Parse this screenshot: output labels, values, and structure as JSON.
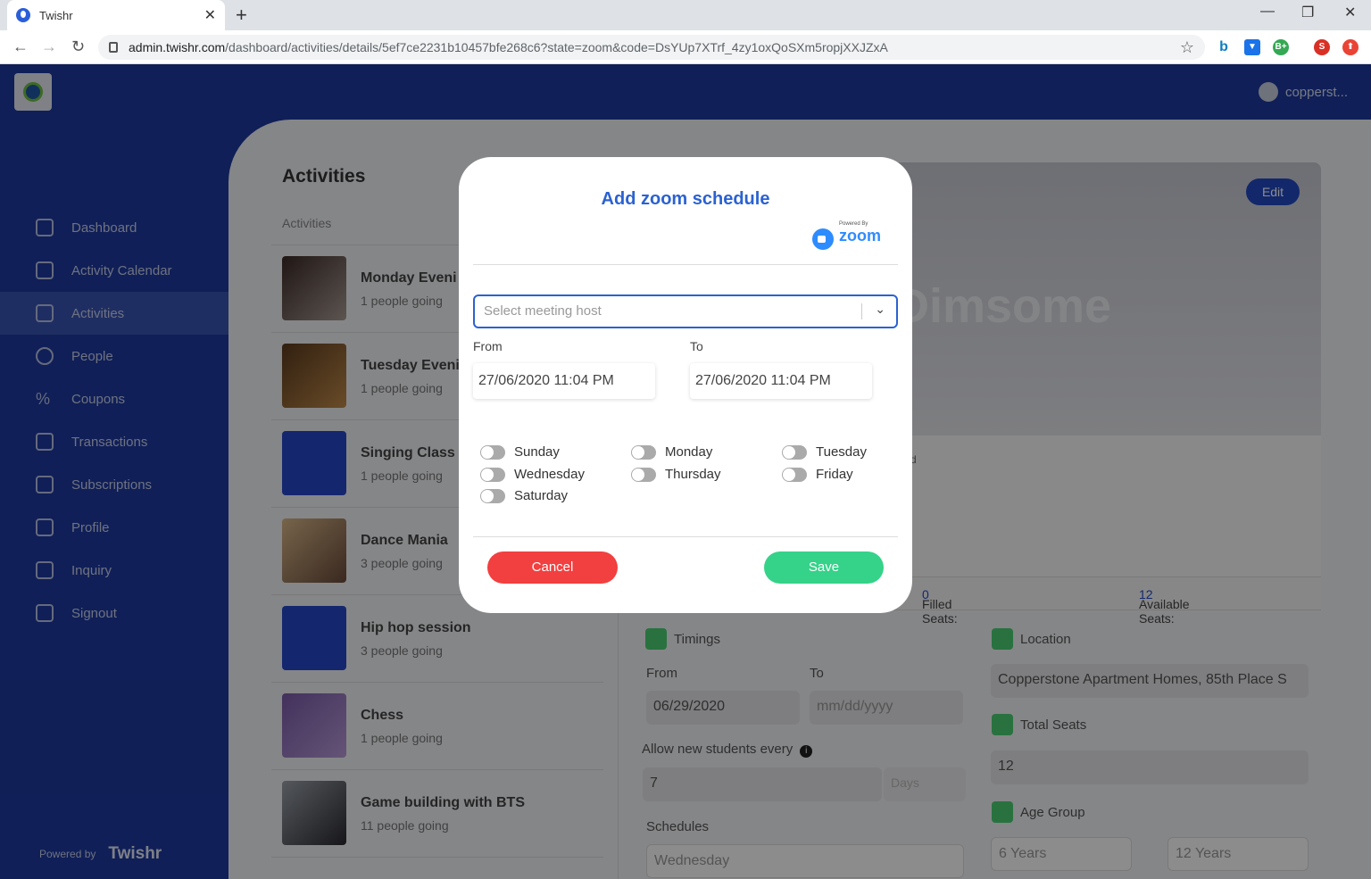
{
  "browser": {
    "tab_title": "Twishr",
    "url_host": "admin.twishr.com",
    "url_path": "/dashboard/activities/details/5ef7ce2231b10457bfe268c6?state=zoom&code=DsYUp7XTrf_4zy1oxQoSXm5ropjXXJZxA",
    "ext_s_label": "S",
    "ext_b_label": "B+"
  },
  "header": {
    "username": "copperst..."
  },
  "sidebar": {
    "items": [
      {
        "label": "Dashboard",
        "icon": "bar-chart-icon"
      },
      {
        "label": "Activity Calendar",
        "icon": "calendar-icon"
      },
      {
        "label": "Activities",
        "icon": "activity-icon"
      },
      {
        "label": "People",
        "icon": "person-icon"
      },
      {
        "label": "Coupons",
        "icon": "percent-icon"
      },
      {
        "label": "Transactions",
        "icon": "dollar-icon"
      },
      {
        "label": "Subscriptions",
        "icon": "list-icon"
      },
      {
        "label": "Profile",
        "icon": "square-icon"
      },
      {
        "label": "Inquiry",
        "icon": "square-icon"
      },
      {
        "label": "Signout",
        "icon": "signout-icon"
      }
    ],
    "active": "Activities",
    "powered_by": "Powered by",
    "brand": "Twishr"
  },
  "main": {
    "title": "Activities",
    "subtitle": "Activities",
    "activities": [
      {
        "title": "Monday Eveni",
        "sub": "1 people going"
      },
      {
        "title": "Tuesday Eveni",
        "sub": "1 people going"
      },
      {
        "title": "Singing Class",
        "sub": "1 people going"
      },
      {
        "title": "Dance Mania",
        "sub": "3 people going"
      },
      {
        "title": "Hip hop session",
        "sub": "3 people going"
      },
      {
        "title": "Chess",
        "sub": "1 people going"
      },
      {
        "title": "Game building with BTS",
        "sub": "11 people going"
      }
    ],
    "banner_text": "Dimsome",
    "edit_label": "Edit",
    "filled_seats_label": "Filled Seats:",
    "filled_seats_value": "0",
    "available_seats_label": "Available Seats:",
    "available_seats_value": "12",
    "stray_d": "d",
    "timings_label": "Timings",
    "from_label": "From",
    "to_label": "To",
    "from_value": "06/29/2020",
    "to_placeholder": "mm/dd/yyyy",
    "allow_label": "Allow new students every",
    "allow_value": "7",
    "allow_unit": "Days",
    "schedules_label": "Schedules",
    "schedules_value": "Wednesday",
    "location_label": "Location",
    "location_value": "Copperstone Apartment Homes, 85th Place S",
    "total_seats_label": "Total Seats",
    "total_seats_value": "12",
    "age_group_label": "Age Group",
    "age_from": "6 Years",
    "age_to": "12 Years"
  },
  "modal": {
    "title": "Add zoom schedule",
    "powered_by": "Powered By",
    "zoom_brand": "zoom",
    "host_placeholder": "Select meeting host",
    "from_label": "From",
    "to_label": "To",
    "from_value": "27/06/2020 11:04 PM",
    "to_value": "27/06/2020 11:04 PM",
    "days": [
      "Sunday",
      "Monday",
      "Tuesday",
      "Wednesday",
      "Thursday",
      "Friday",
      "Saturday"
    ],
    "cancel_label": "Cancel",
    "save_label": "Save"
  }
}
